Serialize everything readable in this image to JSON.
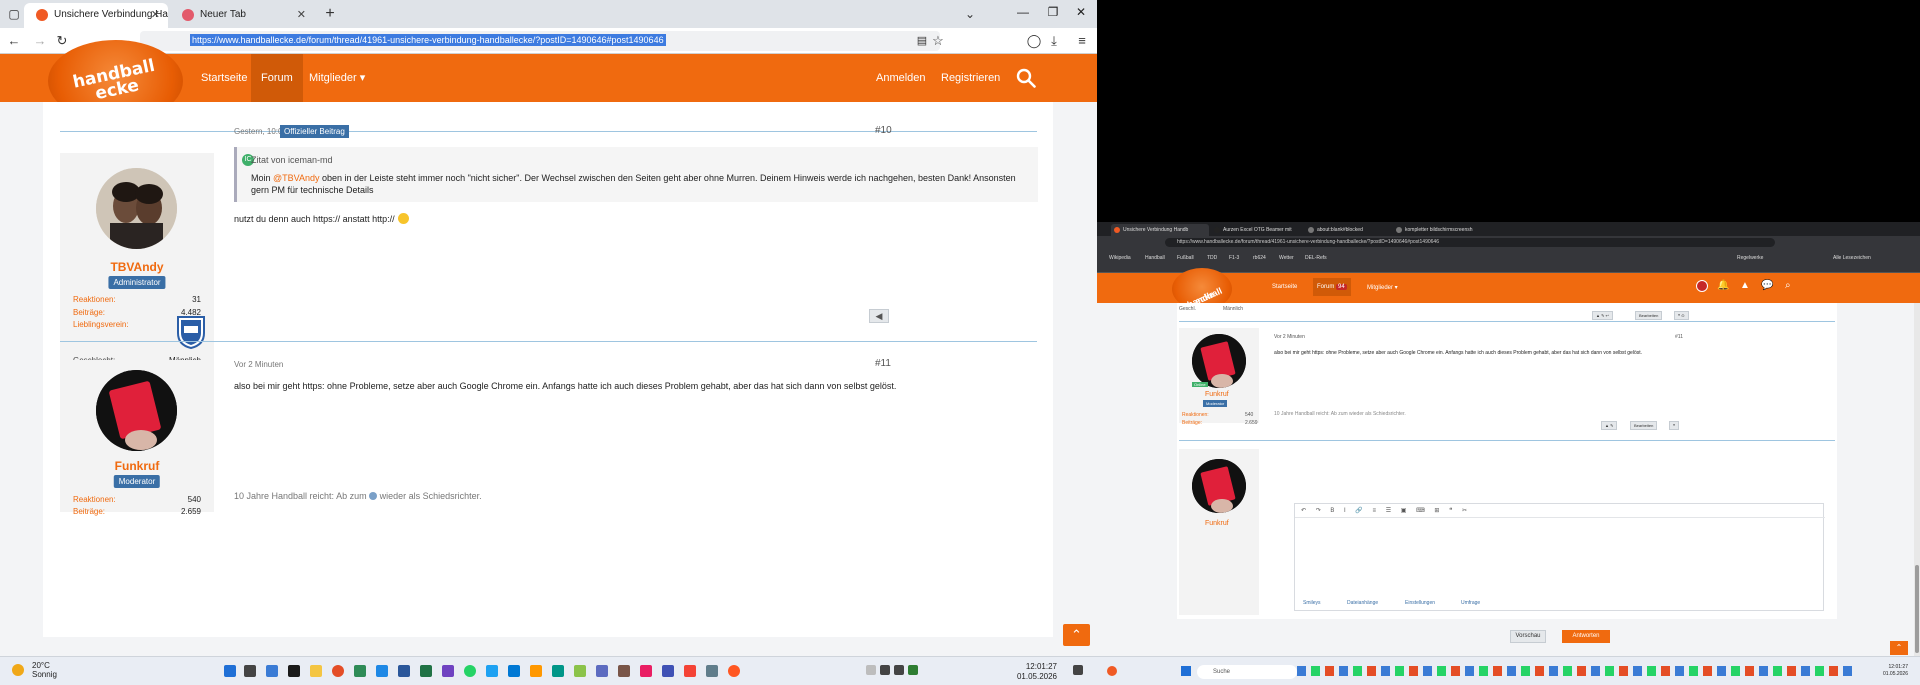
{
  "browser": {
    "tabs": [
      {
        "title": "Unsichere Verbindung Handball",
        "active": true
      },
      {
        "title": "Neuer Tab",
        "active": false
      }
    ],
    "url": "https://www.handballecke.de/forum/thread/41961-unsichere-verbindung-handballecke/?postID=1490646#post1490646"
  },
  "site": {
    "logo_line1": "handball",
    "logo_line2": "ecke",
    "menu": [
      {
        "label": "Startseite"
      },
      {
        "label": "Forum"
      },
      {
        "label": "Mitglieder ▾"
      }
    ],
    "login_label": "Anmelden",
    "register_label": "Registrieren"
  },
  "posts": [
    {
      "author": "TBVAndy",
      "role": "Administrator",
      "time": "Gestern, 10:06",
      "official_badge": "Offizieller Beitrag",
      "number": "#10",
      "stats": [
        {
          "label": "Reaktionen:",
          "value": "31"
        },
        {
          "label": "Beiträge:",
          "value": "4.482"
        },
        {
          "label": "Lieblingsverein:",
          "value": ""
        }
      ],
      "gender_label": "Geschlecht:",
      "gender_value": "Männlich",
      "quote_author": "Zitat von iceman-md",
      "quote_text_1": "Moin ",
      "quote_mention": "@TBVAndy",
      "quote_text_2": " oben in der Leiste steht immer noch \"nicht sicher\". Der Wechsel zwischen den Seiten geht aber ohne Murren. Deinem Hinweis werde ich nachgehen, besten Dank! Ansonsten gern PM für technische Details",
      "text": "nutzt du denn auch https:// anstatt http://"
    },
    {
      "author": "Funkruf",
      "role": "Moderator",
      "time": "Vor 2 Minuten",
      "number": "#11",
      "stats": [
        {
          "label": "Reaktionen:",
          "value": "540"
        },
        {
          "label": "Beiträge:",
          "value": "2.659"
        }
      ],
      "text": "also bei mir geht https: ohne Probleme, setze aber auch Google Chrome ein. Anfangs hatte ich auch dieses Problem gehabt, aber das hat sich dann von selbst gelöst.",
      "signature_1": "10 Jahre Handball reicht: Ab zum ",
      "signature_2": " wieder als Schiedsrichter."
    }
  ],
  "taskbar": {
    "temp": "20°C",
    "weather": "Sonnig",
    "time": "12:01:27",
    "date": "01.05.2026"
  },
  "right": {
    "tabs": [
      {
        "title": "Unsichere Verbindung Handb"
      },
      {
        "title": "Aurzen Excel OTG Beamer mit"
      },
      {
        "title": "about:blank#blocked"
      },
      {
        "title": "kompletter bildschirmscreensh"
      }
    ],
    "url": "https://www.handballecke.de/forum/thread/41961-unsichere-verbindung-handballecke/?postID=1490646#post1490646",
    "bookmarks": [
      "Wikipedia",
      "Handball",
      "Fußball",
      "TDD",
      "F1-3",
      "rb624",
      "Wetter",
      "DEL-Refs"
    ],
    "bookmarks_right": [
      "Regelwerke",
      "Alle Lesezeichen"
    ],
    "menu": [
      "Startseite",
      "Forum",
      "Mitglieder ▾"
    ],
    "forum_badge": "94",
    "gender_label": "Geschl.",
    "gender_value": "Männlich",
    "post_time": "Vor 2 Minuten",
    "post_number": "#11",
    "post_text": "also bei mir geht https: ohne Probleme, setze aber auch Google Chrome ein. Anfangs hatte ich auch dieses Problem gehabt, aber das hat sich dann von selbst gelöst.",
    "signature": "10 Jahre Handball reicht: Ab zum  wieder als Schiedsrichter.",
    "author": "Funkruf",
    "role": "Moderator",
    "online": "Online",
    "stats": [
      {
        "label": "Reaktionen:",
        "value": "540"
      },
      {
        "label": "Beiträge:",
        "value": "2.659"
      }
    ],
    "edit_label": "Bearbeiten",
    "reply_author": "Funkruf",
    "editor_tabs": [
      "Smileys",
      "Dateianhänge",
      "Einstellungen",
      "Umfrage"
    ],
    "preview_label": "Vorschau",
    "reply_label": "Antworten",
    "search_label": "Suche",
    "time": "12:01:27",
    "date": "01.05.2026"
  }
}
